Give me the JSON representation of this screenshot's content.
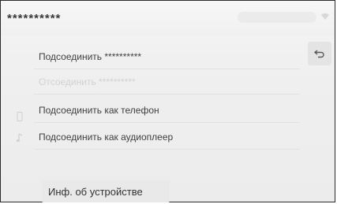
{
  "header": {
    "title": "**********"
  },
  "menu": {
    "items": [
      {
        "label": "Подсоединить **********",
        "enabled": true
      },
      {
        "label": "Отсоединить **********",
        "enabled": false
      },
      {
        "label": "Подсоединить как телефон",
        "enabled": true,
        "icon": "phone-icon"
      },
      {
        "label": "Подсоединить как аудиоплеер",
        "enabled": true,
        "icon": "music-note-icon"
      }
    ]
  },
  "footer": {
    "info_button_label": "Инф. об устройстве"
  },
  "icons": {
    "back": "back-icon",
    "signal": "signal-icon"
  }
}
